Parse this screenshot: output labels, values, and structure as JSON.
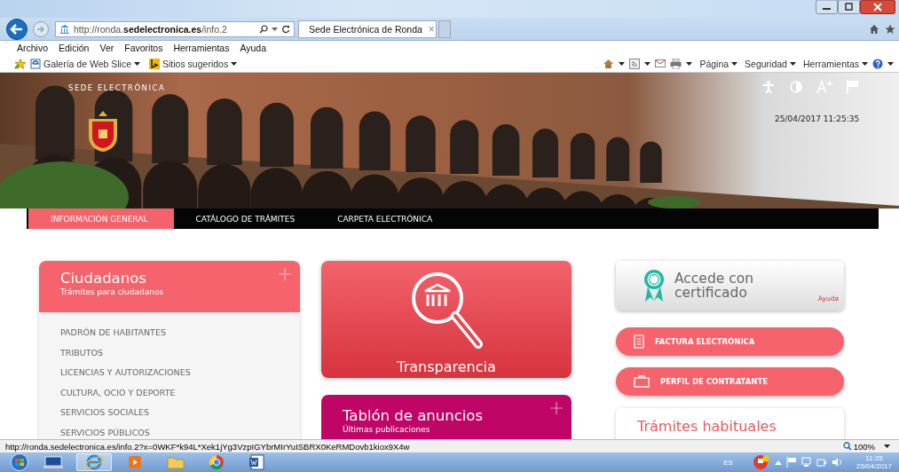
{
  "browser": {
    "address": "http://ronda.**sedelectronica.es**/info.2",
    "tab": {
      "title": "Sede Electrónica de Ronda",
      "close": "×",
      "selected": true
    },
    "menu": [
      "Archivo",
      "Edición",
      "Ver",
      "Favoritos",
      "Herramientas",
      "Ayuda"
    ],
    "favorites": [
      "Galería de Web Slice",
      "Sitios sugeridos"
    ],
    "commands": [
      "Página",
      "Seguridad",
      "Herramientas"
    ]
  },
  "header": {
    "site_title": "SEDE ELECTRÓNICA",
    "datetime": "25/04/2017 11:25:35"
  },
  "nav": [
    {
      "label": "INFORMACIÓN GENERAL",
      "selected": true
    },
    {
      "label": "CATÁLOGO DE TRÁMITES",
      "selected": false
    },
    {
      "label": "CARPETA ELECTRÓNICA",
      "selected": false
    }
  ],
  "ciudadanos": {
    "title": "Ciudadanos",
    "subtitle": "Trámites para ciudadanos",
    "items": [
      "PADRÓN DE HABITANTES",
      "TRIBUTOS",
      "LICENCIAS Y AUTORIZACIONES",
      "CULTURA, OCIO Y DEPORTE",
      "SERVICIOS SOCIALES",
      "SERVICIOS PÚBLICOS"
    ]
  },
  "transparencia": {
    "label": "Transparencia"
  },
  "tablon": {
    "title": "Tablón de anuncios",
    "subtitle": "Últimas publicaciones"
  },
  "certificado": {
    "title": "Accede con certificado",
    "help": "Ayuda"
  },
  "quick_links": [
    {
      "kind": "invoice",
      "label": "FACTURA ELECTRÓNICA"
    },
    {
      "kind": "briefcase",
      "label": "PERFIL DE CONTRATANTE"
    }
  ],
  "tramites": {
    "title": "Trámites habituales"
  },
  "status_bar": {
    "url": "http://ronda.sedelectronica.es/info.2?x=0WKF*k94L*Xek1jYg3VzpIGYbrMIrYuISBRX0KeRMDovb1kiox9X4w",
    "zoom": "100%"
  },
  "taskbar": {
    "language": "ES",
    "time": "11:25",
    "date": "25/04/2017"
  }
}
